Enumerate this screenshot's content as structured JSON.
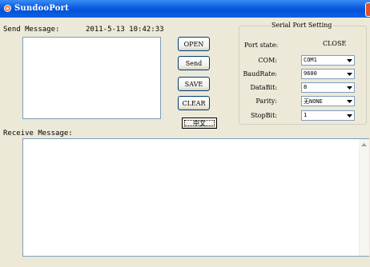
{
  "window": {
    "title": "SundooPort"
  },
  "send": {
    "label": "Send Message:",
    "timestamp": "2011-5-13 10:42:33",
    "value": ""
  },
  "buttons": {
    "open": "OPEN",
    "send": "Send",
    "save": "SAVE",
    "clear": "CLEAR",
    "lang": "中文"
  },
  "serial": {
    "group_title": "Serial Port Setting",
    "port_state_label": "Port state:",
    "port_state_value": "CLOSE",
    "com_label": "COM:",
    "com_value": "COM1",
    "baud_label": "BaudRate:",
    "baud_value": "9600",
    "databit_label": "DataBit:",
    "databit_value": "8",
    "parity_label": "Parity:",
    "parity_value": "无NONE",
    "stopbit_label": "StopBit:",
    "stopbit_value": "1"
  },
  "receive": {
    "label": "Receive Message:",
    "value": ""
  },
  "colors": {
    "titlebar": "#0553d6",
    "window_bg": "#ece9d8",
    "border": "#7f9db9"
  },
  "icons": {
    "title": "app-icon",
    "dropdown": "chevron-down-icon",
    "scroll_up": "scroll-up-arrow-icon"
  }
}
